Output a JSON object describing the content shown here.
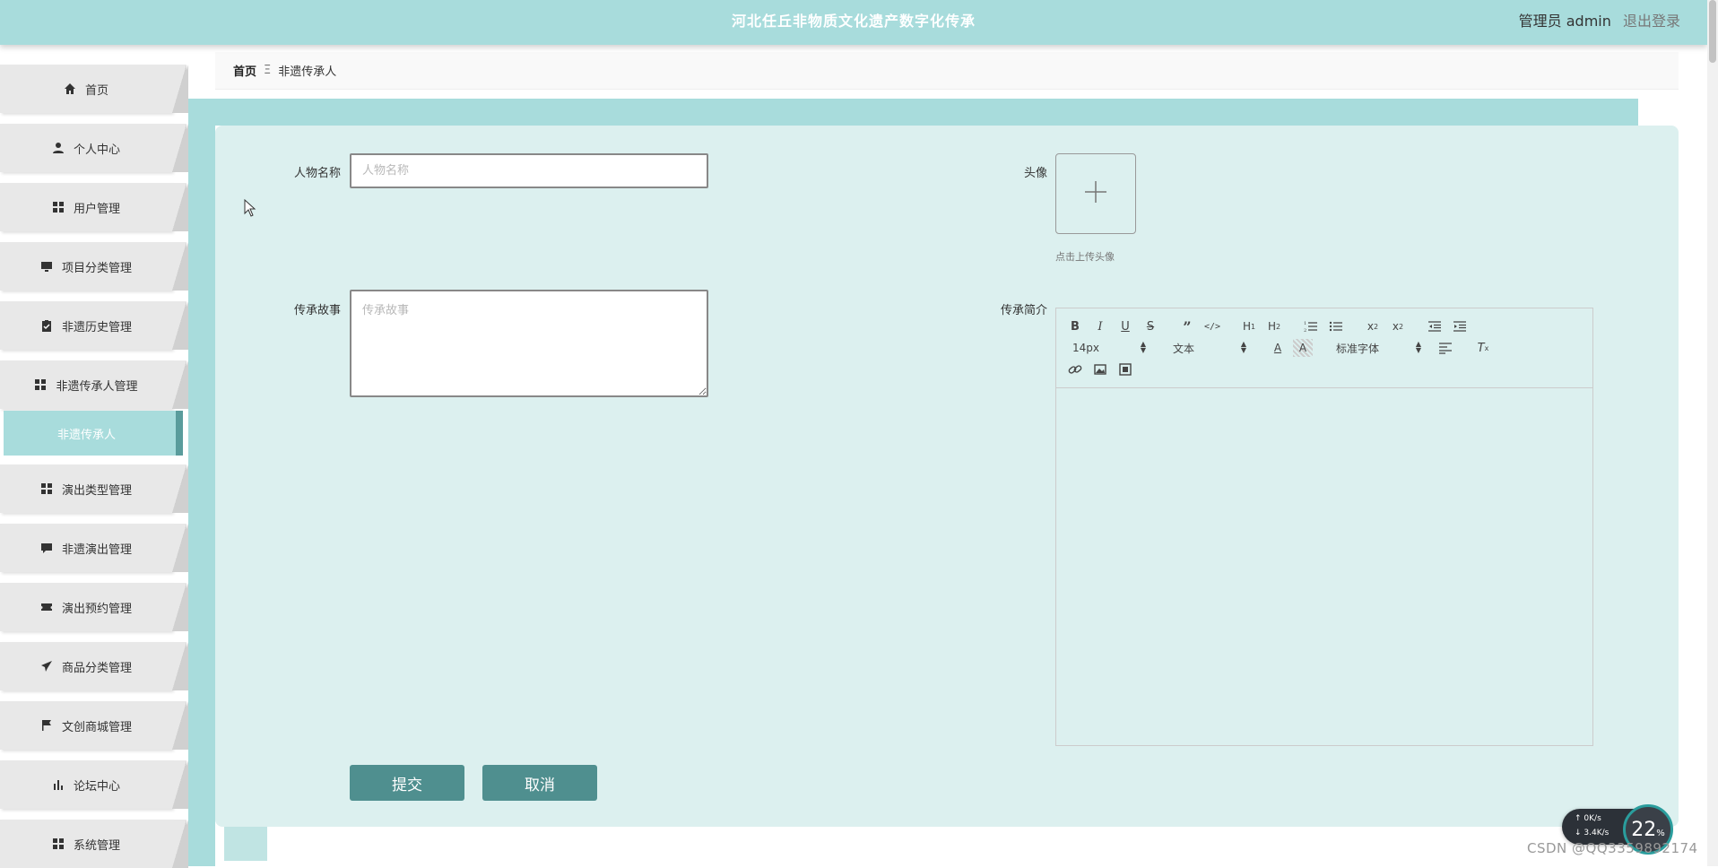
{
  "header": {
    "title": "河北任丘非物质文化遗产数字化传承",
    "user_role": "管理员",
    "user_name": "admin",
    "logout": "退出登录"
  },
  "sidebar": {
    "items": [
      {
        "label": "首页",
        "icon": "home-icon"
      },
      {
        "label": "个人中心",
        "icon": "user-icon"
      },
      {
        "label": "用户管理",
        "icon": "grid-icon"
      },
      {
        "label": "项目分类管理",
        "icon": "monitor-icon"
      },
      {
        "label": "非遗历史管理",
        "icon": "clipboard-icon"
      },
      {
        "label": "非遗传承人管理",
        "icon": "grid-icon"
      },
      {
        "label": "演出类型管理",
        "icon": "grid-icon"
      },
      {
        "label": "非遗演出管理",
        "icon": "comment-icon"
      },
      {
        "label": "演出预约管理",
        "icon": "ticket-icon"
      },
      {
        "label": "商品分类管理",
        "icon": "send-icon"
      },
      {
        "label": "文创商城管理",
        "icon": "flag-icon"
      },
      {
        "label": "论坛中心",
        "icon": "bar-chart-icon"
      },
      {
        "label": "系统管理",
        "icon": "grid-icon"
      }
    ],
    "active_subitem": "非遗传承人"
  },
  "breadcrumb": {
    "home": "首页",
    "separator": "Ξ",
    "current": "非遗传承人"
  },
  "form": {
    "name_label": "人物名称",
    "name_placeholder": "人物名称",
    "avatar_label": "头像",
    "avatar_hint": "点击上传头像",
    "story_label": "传承故事",
    "story_placeholder": "传承故事",
    "intro_label": "传承简介",
    "submit": "提交",
    "cancel": "取消"
  },
  "editor": {
    "font_size": "14px",
    "header_select": "文本",
    "font_family": "标准字体"
  },
  "netspeed": {
    "up": "0K/s",
    "down": "3.4K/s",
    "percent": "22",
    "percent_unit": "%"
  },
  "watermark": "CSDN @QQ3359892174",
  "colors": {
    "accent": "#a8dcdc",
    "button": "#4f8f8f",
    "card_bg": "#dcf0ef"
  }
}
